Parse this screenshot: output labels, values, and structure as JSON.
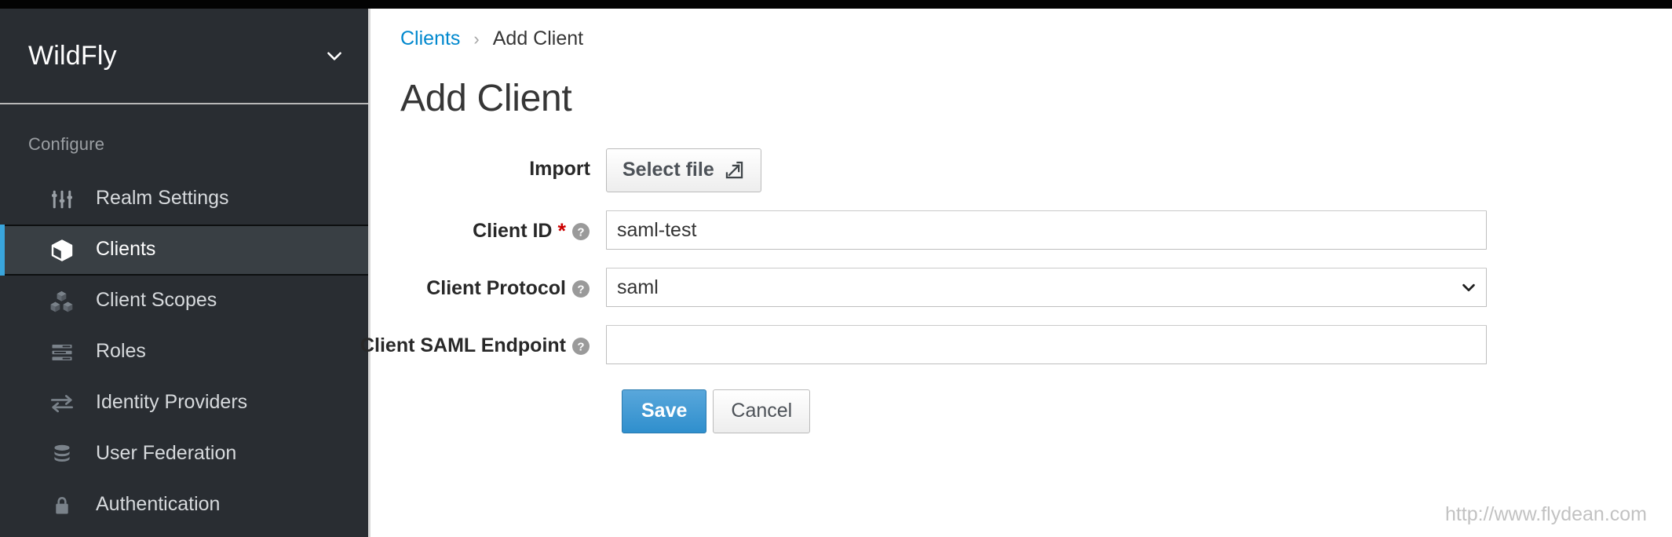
{
  "sidebar": {
    "realm": {
      "name": "WildFly",
      "chevron_icon": "chevron-down-icon"
    },
    "section_title": "Configure",
    "items": [
      {
        "label": "Realm Settings",
        "icon": "sliders-icon",
        "active": false
      },
      {
        "label": "Clients",
        "icon": "cube-icon",
        "active": true
      },
      {
        "label": "Client Scopes",
        "icon": "cubes-icon",
        "active": false
      },
      {
        "label": "Roles",
        "icon": "list-bars-icon",
        "active": false
      },
      {
        "label": "Identity Providers",
        "icon": "exchange-arrows-icon",
        "active": false
      },
      {
        "label": "User Federation",
        "icon": "database-icon",
        "active": false
      },
      {
        "label": "Authentication",
        "icon": "lock-icon",
        "active": false
      }
    ],
    "colors": {
      "background": "#292d32",
      "active_background": "#393f44",
      "active_accent": "#39a5dc"
    }
  },
  "breadcrumb": {
    "parent": "Clients",
    "separator": "›",
    "current": "Add Client"
  },
  "page": {
    "title": "Add Client"
  },
  "form": {
    "import": {
      "label": "Import",
      "button_label": "Select file",
      "button_icon": "import-file-icon"
    },
    "client_id": {
      "label": "Client ID",
      "required_marker": "*",
      "help_icon": "help-circle-icon",
      "value": "saml-test",
      "placeholder": ""
    },
    "client_protocol": {
      "label": "Client Protocol",
      "help_icon": "help-circle-icon",
      "value": "saml",
      "options": [
        "saml"
      ],
      "caret_icon": "chevron-down-icon"
    },
    "client_saml_endpoint": {
      "label": "Client SAML Endpoint",
      "help_icon": "help-circle-icon",
      "value": "",
      "placeholder": ""
    },
    "actions": {
      "save_label": "Save",
      "cancel_label": "Cancel",
      "save_color": "#2f8fcd"
    }
  },
  "watermark": {
    "text": "http://www.flydean.com"
  }
}
